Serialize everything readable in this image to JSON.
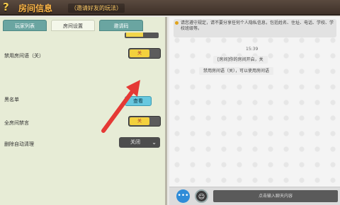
{
  "window": {
    "help_icon": "?",
    "title": "房间信息",
    "subtitle": "（邀请好友的玩法）"
  },
  "tabs": [
    {
      "label": "玩家列表",
      "active": false
    },
    {
      "label": "房间设置",
      "active": true
    },
    {
      "label": "邀请码",
      "active": false
    }
  ],
  "settings": {
    "row1_label": "禁用房间语（关）",
    "row1_toggle": "关",
    "blacklist_label": "黑名单",
    "blacklist_button": "查看",
    "mute_all_label": "全房间禁言",
    "mute_all_toggle": "关",
    "auto_clear_label": "删除自动清理",
    "auto_clear_value": "关闭"
  },
  "chat": {
    "notice": "请您遵守规定，请不要分享任何个人隐私信息，包括姓名、住址、电话、学校、学校班级等。",
    "time": "15:39",
    "message1": "[房间]你的房间开启，关",
    "message2": "禁用房间语（关），可以使用房间语",
    "input_placeholder": "点击输入聊天内容"
  },
  "colors": {
    "title_text": "#ffb84a",
    "toggle_on": "#f3d13d",
    "view_button": "#67c8df",
    "arrow": "#e53935"
  }
}
